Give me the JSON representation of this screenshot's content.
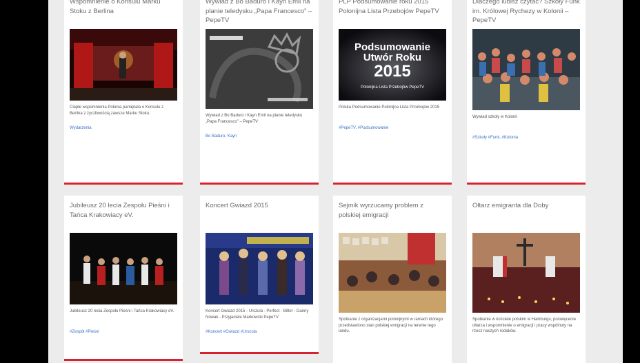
{
  "cards": [
    {
      "title": "Wspomnienie o Konsulu Marku Stoku z Berlina",
      "thumb_kind": "stage",
      "thumb_text": "",
      "description": "Ciepłe wspomnienia Polonia pamiętała o Konsulu z Berlina z życzliwością zawsze Marku Stoku.",
      "tags": "Wydarzenia"
    },
    {
      "title": "Wywiad z Bo Baduro i Kayn Emil na planie teledysku „Papa Francesco” – PepeTV",
      "thumb_kind": "crown",
      "thumb_text": "",
      "thumb_text2": "",
      "description": "Wywiad z Bo Baduro i Kayn Emil na planie teledysku „Papa Francesco” – PepeTV",
      "tags": "Bo Baduro, Kayn"
    },
    {
      "title": "PLP Podsumowanie roku 2015 Polonijna Lista Przebojów PepeTV",
      "thumb_kind": "summary",
      "thumb_text": "Podsumowanie",
      "thumb_text2": "Utwór Roku",
      "thumb_text3": "2015",
      "thumb_text4": "Polonijna Lista Przebojów PepeTV",
      "description": "Polska Podsumowanie Polonijna Lista Przebojów 2015",
      "tags": "#PepeTV, #Podsumowanie"
    },
    {
      "title": "Dlaczego lubisz czytać? Szkoły Funk im. Królowej Rychezy w Kolonii – PepeTV",
      "thumb_kind": "crowd",
      "thumb_text": "",
      "description": "Wywiad szkoły w Kolonii",
      "tags": "#Szkoły #Funk, #Kolonia"
    },
    {
      "title": "Jubileusz 20 lecia Zespołu Pieśni i Tańca Krakowiacy eV.",
      "thumb_kind": "dance",
      "thumb_text": "",
      "description": "Jubileusz 20 lecia Zespołu Pieśni i Tańca Krakowiacy eV.",
      "tags": "#Zespół #Pieśni"
    },
    {
      "title": "Koncert Gwiazd 2015",
      "thumb_kind": "concert",
      "thumb_text": "",
      "description": "Koncert Gwiazd 2015 - Urszula - Perfect - Bitter - Danny Nowak - Przyjaciele Markowski PepeTV",
      "tags": "#Koncert #Gwiazd #Urszula"
    },
    {
      "title": "Sejmik wyrzucamy problem z polskiej emigracji",
      "thumb_kind": "meeting",
      "thumb_text": "",
      "description": "Spotkanie z organizacjami polonijnymi w ramach którego przedstawiono stan polskiej emigracji na terenie tego landu.",
      "tags": ""
    },
    {
      "title": "Ołtarz emigranta dla Doby",
      "thumb_kind": "church",
      "thumb_text": "",
      "description": "Spotkanie w kościele polskim w Hamburgu, poświęcenie ołtarza i wspomnienie o emigracji i pracy wspólnoty na rzecz naszych rodaków.",
      "tags": ""
    }
  ]
}
